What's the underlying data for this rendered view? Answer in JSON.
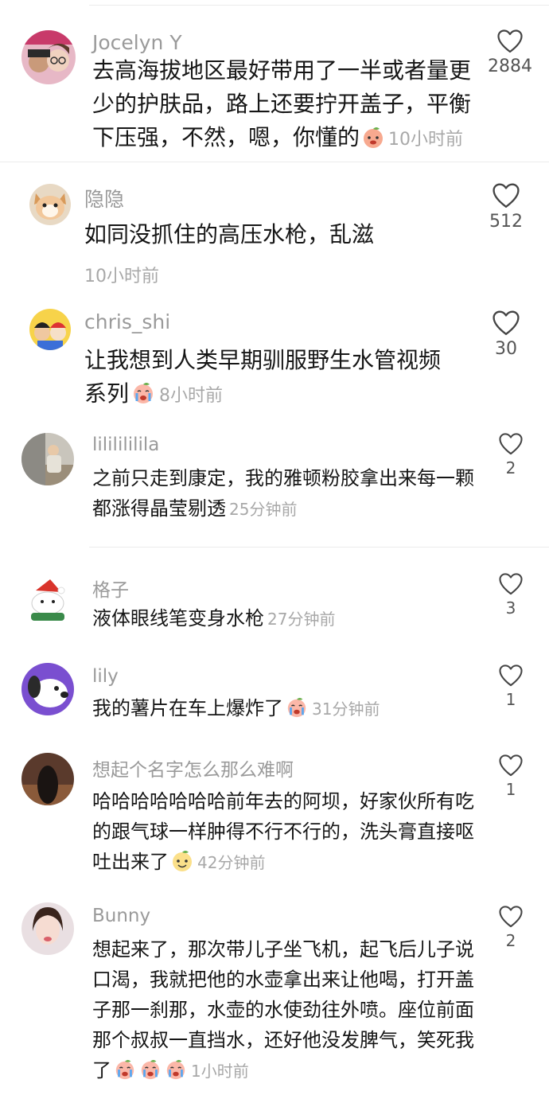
{
  "comments": [
    {
      "user": "Jocelyn Y",
      "text": "去高海拔地区最好带用了一半或者量更少的护肤品，路上还要拧开盖子，平衡下压强，不然，嗯，你懂的",
      "time": "10小时前",
      "likes": "2884",
      "avatar_icon": "couple-photo-avatar",
      "emoji": [
        "peach-face-emoji"
      ]
    },
    {
      "user": "隐隐",
      "text": "如同没抓住的高压水枪，乱滋",
      "time": "10小时前",
      "likes": "512",
      "avatar_icon": "cat-avatar",
      "emoji": []
    },
    {
      "user": "chris_shi",
      "text": "让我想到人类早期驯服野生水管视频系列",
      "time": "8小时前",
      "likes": "30",
      "avatar_icon": "cartoon-avatar",
      "emoji": [
        "crying-emoji"
      ]
    },
    {
      "user": "lililililila",
      "text": "之前只走到康定，我的雅顿粉胶拿出来每一颗都涨得晶莹剔透",
      "time": "25分钟前",
      "likes": "2",
      "avatar_icon": "person-sitting-avatar",
      "emoji": []
    },
    {
      "user": "格子",
      "text": "液体眼线笔变身水枪",
      "time": "27分钟前",
      "likes": "3",
      "avatar_icon": "santa-avatar",
      "emoji": []
    },
    {
      "user": "lily",
      "text": "我的薯片在车上爆炸了",
      "time": "31分钟前",
      "likes": "1",
      "avatar_icon": "dog-avatar",
      "emoji": [
        "crying-emoji"
      ]
    },
    {
      "user": "想起个名字怎么那么难啊",
      "text": "哈哈哈哈哈哈哈前年去的阿坝，好家伙所有吃的跟气球一样肿得不行不行的，洗头膏直接呕吐出来了",
      "time": "42分钟前",
      "likes": "1",
      "avatar_icon": "dark-hair-avatar",
      "emoji": [
        "smile-bun-emoji"
      ]
    },
    {
      "user": "Bunny",
      "text": "想起来了，那次带儿子坐飞机，起飞后儿子说口渴，我就把他的水壶拿出来让他喝，打开盖子那一刹那，水壶的水使劲往外喷。座位前面那个叔叔一直挡水，还好他没发脾气，笑死我了",
      "time": "1小时前",
      "likes": "2",
      "avatar_icon": "woman-selfie-avatar",
      "emoji": [
        "crying-emoji",
        "crying-emoji",
        "crying-emoji"
      ]
    }
  ]
}
